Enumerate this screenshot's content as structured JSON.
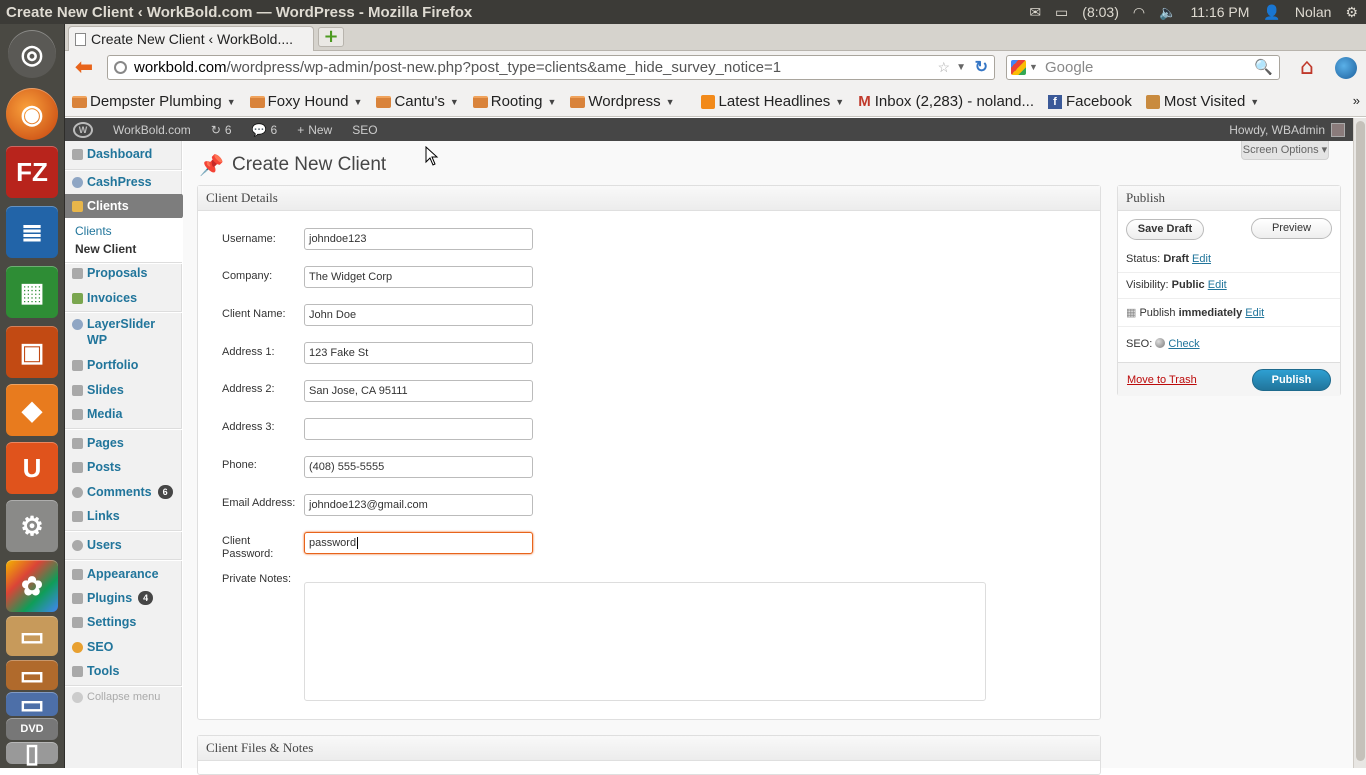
{
  "os": {
    "window_title": "Create New Client ‹ WorkBold.com — WordPress - Mozilla Firefox",
    "battery": "(8:03)",
    "clock": "11:16 PM",
    "user": "Nolan"
  },
  "browser": {
    "tab_title": "Create New Client ‹ WorkBold....",
    "url_domain": "workbold.com",
    "url_path": "/wordpress/wp-admin/post-new.php?post_type=clients&ame_hide_survey_notice=1",
    "search_placeholder": "Google",
    "bookmarks": [
      {
        "label": "Dempster Plumbing"
      },
      {
        "label": "Foxy Hound"
      },
      {
        "label": "Cantu's"
      },
      {
        "label": "Rooting"
      },
      {
        "label": "Wordpress"
      },
      {
        "label": "Latest Headlines"
      },
      {
        "label": "Inbox (2,283) - noland..."
      },
      {
        "label": "Facebook"
      },
      {
        "label": "Most Visited"
      }
    ]
  },
  "adminbar": {
    "site": "WorkBold.com",
    "updates": "6",
    "comments": "6",
    "new": "New",
    "seo": "SEO",
    "howdy": "Howdy, WBAdmin"
  },
  "menu": {
    "dashboard": "Dashboard",
    "cashpress": "CashPress",
    "clients": "Clients",
    "sub_clients": "Clients",
    "sub_new_client": "New Client",
    "proposals": "Proposals",
    "invoices": "Invoices",
    "layerslider": "LayerSlider",
    "layerslider2": "WP",
    "portfolio": "Portfolio",
    "slides": "Slides",
    "media": "Media",
    "pages": "Pages",
    "posts": "Posts",
    "comments": "Comments",
    "comments_badge": "6",
    "links": "Links",
    "users": "Users",
    "appearance": "Appearance",
    "plugins": "Plugins",
    "plugins_badge": "4",
    "settings": "Settings",
    "seo": "SEO",
    "tools": "Tools",
    "collapse": "Collapse menu"
  },
  "page": {
    "title": "Create New Client",
    "screen_options": "Screen Options"
  },
  "client_details": {
    "heading": "Client Details",
    "fields": [
      {
        "label": "Username:",
        "value": "johndoe123"
      },
      {
        "label": "Company:",
        "value": "The Widget Corp"
      },
      {
        "label": "Client Name:",
        "value": "John Doe"
      },
      {
        "label": "Address 1:",
        "value": "123 Fake St"
      },
      {
        "label": "Address 2:",
        "value": "San Jose, CA 95111"
      },
      {
        "label": "Address 3:",
        "value": ""
      },
      {
        "label": "Phone:",
        "value": "(408) 555-5555"
      },
      {
        "label": "Email Address:",
        "value": "johndoe123@gmail.com"
      }
    ],
    "password_label_1": "Client",
    "password_label_2": "Password:",
    "password_value": "password",
    "notes_label": "Private Notes:"
  },
  "files": {
    "heading": "Client Files & Notes"
  },
  "publish": {
    "heading": "Publish",
    "save_draft": "Save Draft",
    "preview": "Preview",
    "status_label": "Status:",
    "status_value": "Draft",
    "visibility_label": "Visibility:",
    "visibility_value": "Public",
    "publish_label": "Publish",
    "publish_value": "immediately",
    "edit": "Edit",
    "seo_label": "SEO:",
    "seo_check": "Check",
    "trash": "Move to Trash",
    "publish_button": "Publish"
  }
}
